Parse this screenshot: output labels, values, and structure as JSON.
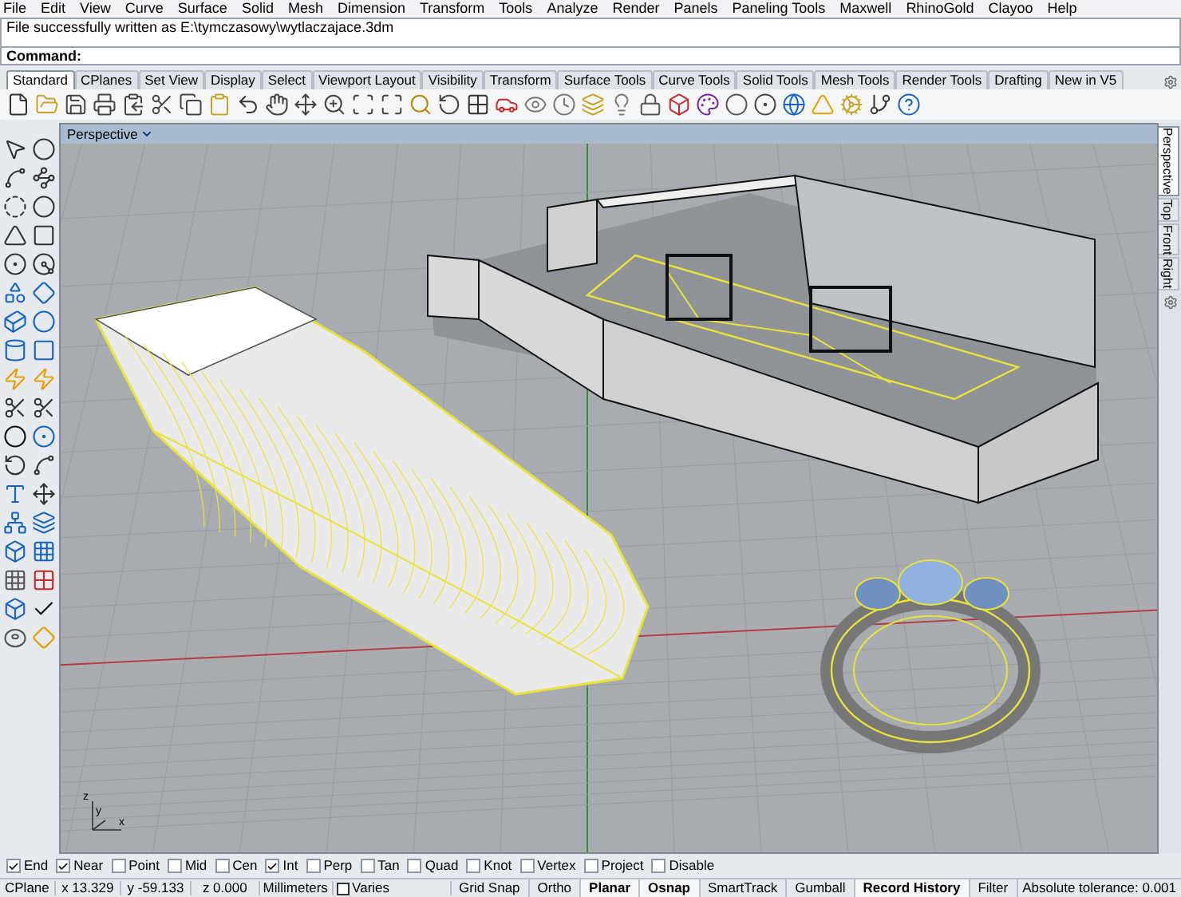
{
  "menu": [
    "File",
    "Edit",
    "View",
    "Curve",
    "Surface",
    "Solid",
    "Mesh",
    "Dimension",
    "Transform",
    "Tools",
    "Analyze",
    "Render",
    "Panels",
    "Paneling Tools",
    "Maxwell",
    "RhinoGold",
    "Clayoo",
    "Help"
  ],
  "command": {
    "history": "File successfully written as E:\\tymczasowy\\wytlaczajace.3dm",
    "prompt": "Command:"
  },
  "toolbar_tabs": [
    {
      "label": "Standard",
      "selected": true
    },
    {
      "label": "CPlanes",
      "selected": false
    },
    {
      "label": "Set View",
      "selected": false
    },
    {
      "label": "Display",
      "selected": false
    },
    {
      "label": "Select",
      "selected": false
    },
    {
      "label": "Viewport Layout",
      "selected": false
    },
    {
      "label": "Visibility",
      "selected": false
    },
    {
      "label": "Transform",
      "selected": false
    },
    {
      "label": "Surface Tools",
      "selected": false
    },
    {
      "label": "Curve Tools",
      "selected": false
    },
    {
      "label": "Solid Tools",
      "selected": false
    },
    {
      "label": "Mesh Tools",
      "selected": false
    },
    {
      "label": "Render Tools",
      "selected": false
    },
    {
      "label": "Drafting",
      "selected": false
    },
    {
      "label": "New in V5",
      "selected": false
    }
  ],
  "viewport": {
    "title": "Perspective",
    "axis_labels": [
      "y",
      "x",
      "z"
    ]
  },
  "view_tabs": [
    {
      "label": "Perspective",
      "selected": true
    },
    {
      "label": "Top",
      "selected": false
    },
    {
      "label": "Front",
      "selected": false
    },
    {
      "label": "Right",
      "selected": false
    }
  ],
  "osnaps": [
    {
      "label": "End",
      "checked": true
    },
    {
      "label": "Near",
      "checked": true
    },
    {
      "label": "Point",
      "checked": false
    },
    {
      "label": "Mid",
      "checked": false
    },
    {
      "label": "Cen",
      "checked": false
    },
    {
      "label": "Int",
      "checked": true
    },
    {
      "label": "Perp",
      "checked": false
    },
    {
      "label": "Tan",
      "checked": false
    },
    {
      "label": "Quad",
      "checked": false
    },
    {
      "label": "Knot",
      "checked": false
    },
    {
      "label": "Vertex",
      "checked": false
    },
    {
      "label": "Project",
      "checked": false
    },
    {
      "label": "Disable",
      "checked": false
    }
  ],
  "status_bar": {
    "cplane": "CPlane",
    "x": "x 13.329",
    "y": "y -59.133",
    "z": "z 0.000",
    "units": "Millimeters",
    "layer": "Varies",
    "panes": [
      {
        "label": "Grid Snap",
        "on": false
      },
      {
        "label": "Ortho",
        "on": false
      },
      {
        "label": "Planar",
        "on": true
      },
      {
        "label": "Osnap",
        "on": true
      },
      {
        "label": "SmartTrack",
        "on": false
      },
      {
        "label": "Gumball",
        "on": false
      },
      {
        "label": "Record History",
        "on": true
      },
      {
        "label": "Filter",
        "on": false
      }
    ],
    "tolerance": "Absolute tolerance: 0.001"
  }
}
